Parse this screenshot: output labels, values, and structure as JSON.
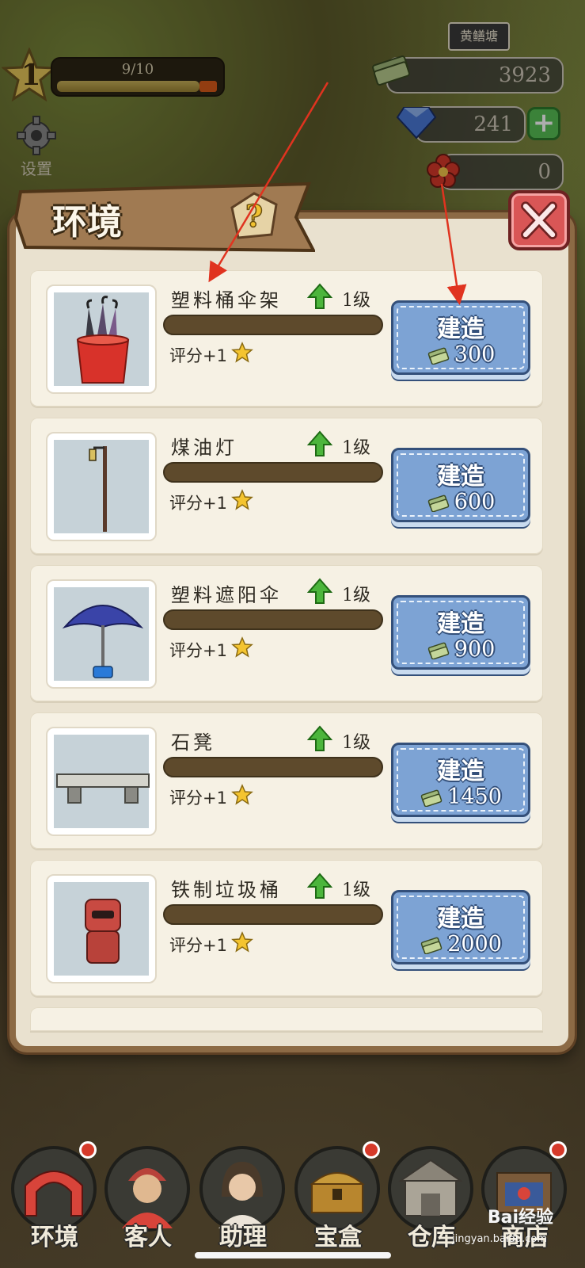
{
  "hud": {
    "level": "1",
    "xp_text": "9/10",
    "xp_progress": 0.9,
    "settings_label": "设置",
    "location_tag": "黄鳝塘",
    "cash": "3923",
    "gems": "241",
    "flowers": "0"
  },
  "panel": {
    "title": "环境",
    "build_label": "建造",
    "rating_label": "评分+1"
  },
  "items": [
    {
      "name": "塑料桶伞架",
      "level": "1级",
      "cost": "300",
      "icon": "umbrella-bucket-icon"
    },
    {
      "name": "煤油灯",
      "level": "1级",
      "cost": "600",
      "icon": "kerosene-lamp-icon"
    },
    {
      "name": "塑料遮阳伞",
      "level": "1级",
      "cost": "900",
      "icon": "sun-umbrella-icon"
    },
    {
      "name": "石凳",
      "level": "1级",
      "cost": "1450",
      "icon": "stone-bench-icon"
    },
    {
      "name": "铁制垃圾桶",
      "level": "1级",
      "cost": "2000",
      "icon": "trash-can-icon"
    }
  ],
  "nav": [
    {
      "label": "环境",
      "badge": true,
      "icon": "arch-icon"
    },
    {
      "label": "客人",
      "badge": false,
      "icon": "guest-icon"
    },
    {
      "label": "助理",
      "badge": false,
      "icon": "assistant-icon"
    },
    {
      "label": "宝盒",
      "badge": true,
      "icon": "chest-icon"
    },
    {
      "label": "仓库",
      "badge": false,
      "icon": "warehouse-icon"
    },
    {
      "label": "商店",
      "badge": true,
      "icon": "shop-icon"
    }
  ],
  "watermark": {
    "brand": "Bai经验",
    "url": "jingyan.baidu.com"
  },
  "colors": {
    "build_button": "#7da3d4",
    "close_button": "#d95656",
    "arrow": "#e0331f"
  }
}
